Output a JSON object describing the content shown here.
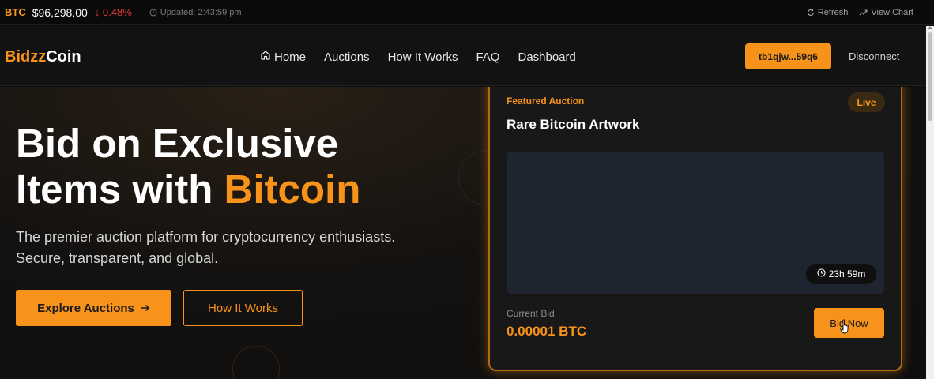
{
  "ticker": {
    "symbol": "BTC",
    "price": "$96,298.00",
    "change": "↓ 0.48%",
    "updated": "Updated: 2:43:59 pm",
    "refresh_label": "Refresh",
    "view_chart_label": "View Chart"
  },
  "brand": {
    "part1": "Bidzz",
    "part2": "Coin"
  },
  "nav": {
    "items": [
      {
        "label": "Home",
        "icon": "home-icon"
      },
      {
        "label": "Auctions"
      },
      {
        "label": "How It Works"
      },
      {
        "label": "FAQ"
      },
      {
        "label": "Dashboard"
      }
    ],
    "wallet_label": "tb1qjw...59q6",
    "disconnect_label": "Disconnect"
  },
  "hero": {
    "title_line1": "Bid on Exclusive",
    "title_line2_prefix": "Items with ",
    "title_accent": "Bitcoin",
    "subtitle_line1": "The premier auction platform for cryptocurrency enthusiasts.",
    "subtitle_line2": "Secure, transparent, and global.",
    "primary_label": "Explore Auctions",
    "secondary_label": "How It Works"
  },
  "featured": {
    "label": "Featured Auction",
    "title": "Rare Bitcoin Artwork",
    "status": "Live",
    "timer": "23h 59m",
    "current_bid_label": "Current Bid",
    "current_bid_value": "0.00001 BTC",
    "bid_button": "Bid Now"
  },
  "colors": {
    "accent": "#f7931a",
    "negative": "#e53935",
    "background": "#0d0d0d"
  }
}
